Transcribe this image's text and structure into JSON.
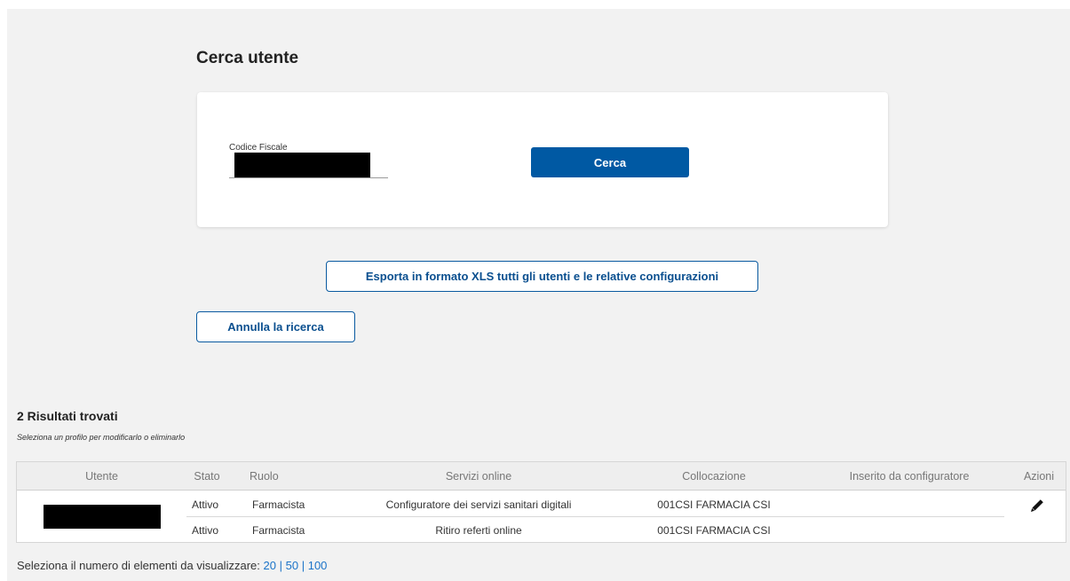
{
  "page": {
    "title": "Cerca utente"
  },
  "search": {
    "field_label": "Codice Fiscale",
    "search_button": "Cerca"
  },
  "actions": {
    "export_button": "Esporta in formato XLS tutti gli utenti e le relative configurazioni",
    "cancel_button": "Annulla la ricerca"
  },
  "results": {
    "title": "2 Risultati trovati",
    "subtitle": "Seleziona un profilo per modificarlo o eliminarlo",
    "columns": [
      "Utente",
      "Stato",
      "Ruolo",
      "Servizi online",
      "Collocazione",
      "Inserito da configuratore",
      "Azioni"
    ],
    "rows": [
      {
        "stato": "Attivo",
        "ruolo": "Farmacista",
        "servizi": "Configuratore dei servizi sanitari digitali",
        "collocazione": "001CSI FARMACIA CSI",
        "inserito": ""
      },
      {
        "stato": "Attivo",
        "ruolo": "Farmacista",
        "servizi": "Ritiro referti online",
        "collocazione": "001CSI FARMACIA CSI",
        "inserito": ""
      }
    ],
    "action_icon": "pencil-icon"
  },
  "pager": {
    "label": "Seleziona il numero di elementi da visualizzare:",
    "options": [
      "20",
      "50",
      "100"
    ],
    "separator": "|"
  },
  "colors": {
    "primary": "#0059a3",
    "link": "#1a73c8",
    "background": "#f2f2f2"
  }
}
